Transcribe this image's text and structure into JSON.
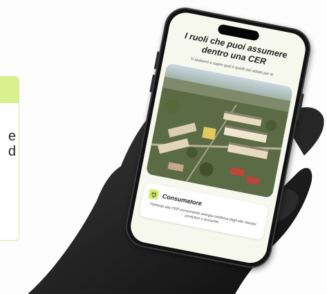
{
  "background": {
    "card_text_lines": [
      "e",
      "d"
    ]
  },
  "app": {
    "title": "I ruoli che puoi assumere dentro una CER",
    "subtitle": "Ti aiutiamo a capire qual è quello più adatto per te",
    "photo_icon": "aerial-city-photo",
    "role": {
      "icon": "plug-icon",
      "name": "Consumatore",
      "description": "Partecipi alla CER consumando energia condivisa dagli altri membri produttori e prosumer."
    }
  },
  "colors": {
    "accent": "#cfee6b",
    "screen_bg": "#f6f8ee",
    "phone_frame": "#121212"
  }
}
